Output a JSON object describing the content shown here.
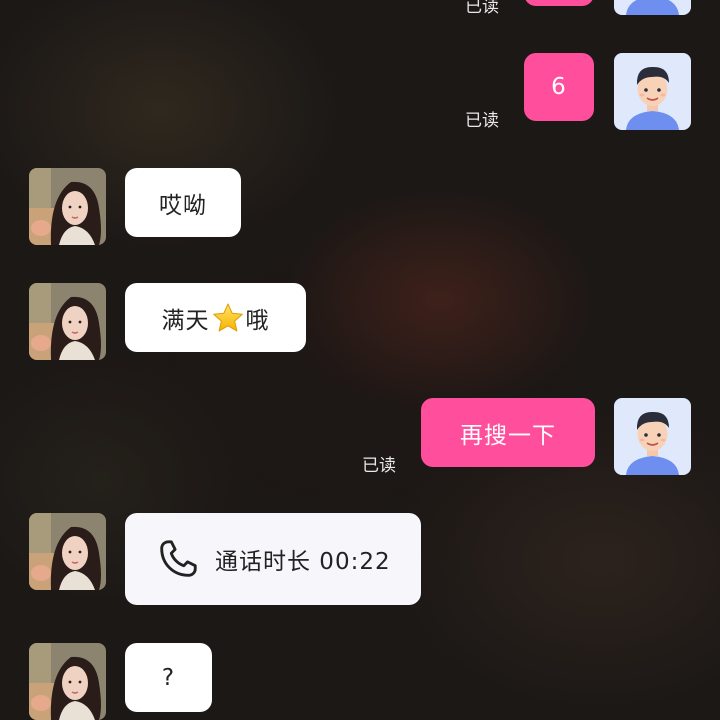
{
  "messages": [
    {
      "id": 1,
      "side": "out",
      "type": "text",
      "text": "",
      "read_label": "已读"
    },
    {
      "id": 2,
      "side": "out",
      "type": "text",
      "text": "6",
      "read_label": "已读"
    },
    {
      "id": 3,
      "side": "in",
      "type": "text",
      "text": "哎呦"
    },
    {
      "id": 4,
      "side": "in",
      "type": "text",
      "text_before": "满天",
      "emoji": "star",
      "text_after": "哦"
    },
    {
      "id": 5,
      "side": "out",
      "type": "text",
      "text": "再搜一下",
      "read_label": "已读"
    },
    {
      "id": 6,
      "side": "in",
      "type": "call",
      "icon": "phone-icon",
      "text": "通话时长 00:22"
    },
    {
      "id": 7,
      "side": "in",
      "type": "text",
      "text": "?"
    }
  ],
  "colors": {
    "outgoing_bubble": "#ff4f9c",
    "incoming_bubble": "#ffffff",
    "call_bubble": "#f7f7fb",
    "read_label": "#e8e8e8"
  },
  "avatars": {
    "self": "cartoon-man-avatar",
    "contact": "woman-photo-avatar"
  }
}
